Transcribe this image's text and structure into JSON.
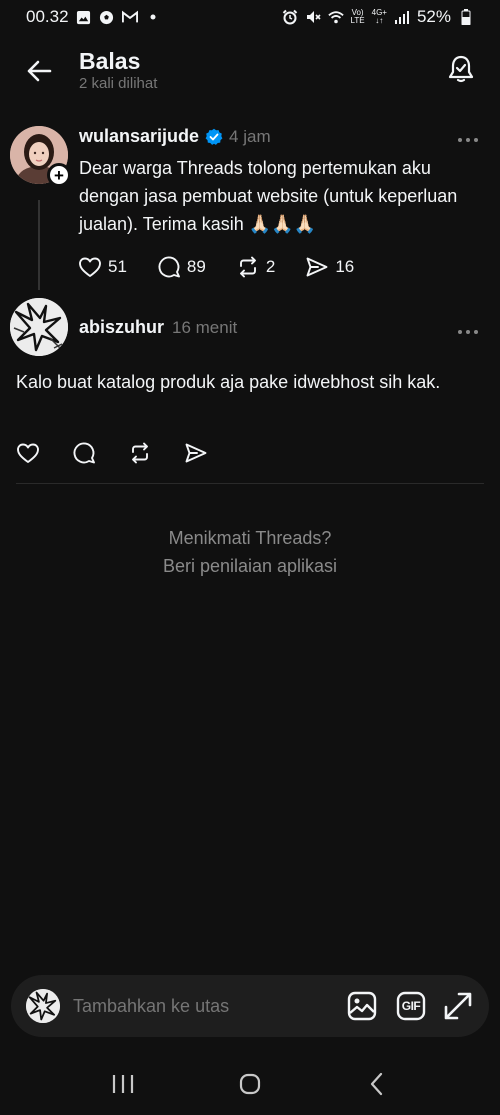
{
  "status_bar": {
    "time": "00.32",
    "battery": "52%",
    "network_volte": "Vo)",
    "network_lte": "LTE",
    "network_4g": "4G+"
  },
  "header": {
    "title": "Balas",
    "subtitle": "2 kali dilihat"
  },
  "post": {
    "username": "wulansarijude",
    "time": "4 jam",
    "text": "Dear warga Threads tolong pertemukan aku dengan jasa pembuat website (untuk keperluan jualan). Terima kasih 🙏🏻🙏🏻🙏🏻",
    "likes": "51",
    "comments": "89",
    "reposts": "2",
    "shares": "16"
  },
  "reply": {
    "username": "abiszuhur",
    "time": "16 menit",
    "text": "Kalo buat katalog produk aja pake idwebhost sih kak."
  },
  "rate_prompt": {
    "line1": "Menikmati Threads?",
    "line2": "Beri penilaian aplikasi"
  },
  "composer": {
    "placeholder": "Tambahkan ke utas",
    "gif_label": "GIF"
  },
  "colors": {
    "background": "#101010",
    "verified": "#0095f6",
    "muted_text": "#777777",
    "composer_bg": "#1e1e1e"
  },
  "icons": [
    "back-arrow-icon",
    "notify-bell-check-icon",
    "verified-badge-icon",
    "heart-icon",
    "comment-icon",
    "repost-icon",
    "share-icon",
    "more-icon",
    "image-icon",
    "gif-icon",
    "expand-icon",
    "recents-icon",
    "home-icon",
    "nav-back-icon"
  ]
}
